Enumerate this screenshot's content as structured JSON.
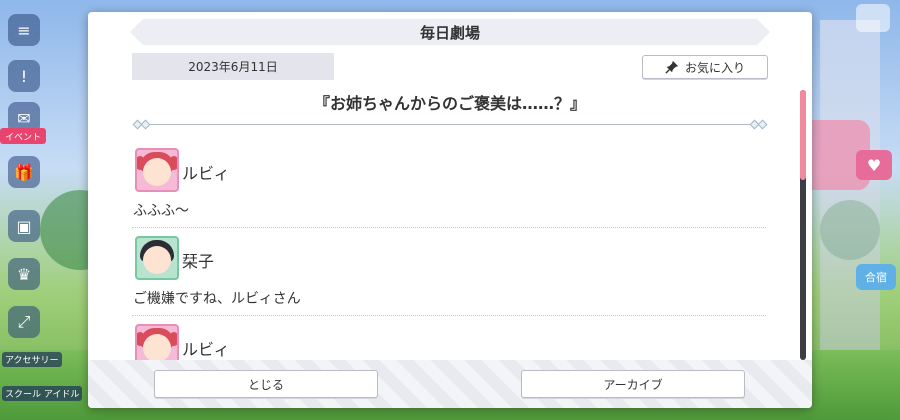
{
  "dialog": {
    "title": "毎日劇場",
    "date": "2023年6月11日",
    "favorite_label": "お気に入り",
    "episode_title": "『お姉ちゃんからのご褒美は……？』"
  },
  "entries": [
    {
      "name": "ルビィ",
      "text": "ふふふ〜",
      "avatar": "ruby"
    },
    {
      "name": "栞子",
      "text": "ご機嫌ですね、ルビィさん",
      "avatar": "shioriko"
    },
    {
      "name": "ルビィ",
      "text": "",
      "avatar": "ruby"
    }
  ],
  "buttons": {
    "close": "とじる",
    "archive": "アーカイブ"
  },
  "side_menu": {
    "event_label": "イベント",
    "accessory_label": "アクセサリー",
    "school_idol_label": "スクール アイドル"
  },
  "right_side": {
    "goukaku": "合宿"
  },
  "colors": {
    "scroll_thumb": "#f08a9c",
    "avatar_pink": "#f6b9d6",
    "avatar_green": "#b7e3cf"
  }
}
